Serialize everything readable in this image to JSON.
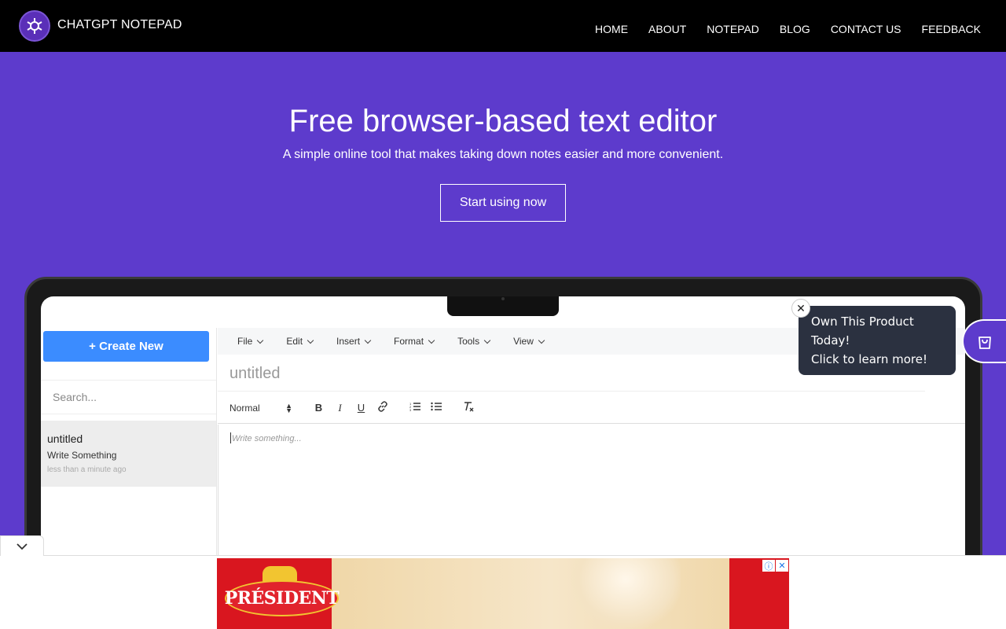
{
  "header": {
    "brand": "CHATGPT NOTEPAD",
    "nav": [
      "HOME",
      "ABOUT",
      "NOTEPAD",
      "BLOG",
      "CONTACT US",
      "FEEDBACK"
    ]
  },
  "hero": {
    "title": "Free browser-based text editor",
    "subtitle": "A simple online tool that makes taking down notes easier and more convenient.",
    "cta": "Start using now"
  },
  "app": {
    "create_label": "+ Create New",
    "search_placeholder": "Search...",
    "notes": [
      {
        "title": "untitled",
        "snippet": "Write Something",
        "time": "less than a minute ago"
      }
    ],
    "menus": [
      "File",
      "Edit",
      "Insert",
      "Format",
      "Tools",
      "View"
    ],
    "doc_title": "untitled",
    "format_select": "Normal",
    "toolbar_buttons": [
      "B",
      "I",
      "U"
    ],
    "editor_placeholder": "Write something..."
  },
  "tooltip": {
    "line1": "Own This Product",
    "line2": "Today!",
    "line3": "Click to learn more!"
  },
  "ad": {
    "brand": "PRÉSIDENT"
  },
  "colors": {
    "hero_bg": "#5d3bcc",
    "nav_bg": "#000000",
    "create_button": "#3b8cff",
    "tooltip_bg": "#2b3140",
    "ad_red": "#d9161f"
  }
}
